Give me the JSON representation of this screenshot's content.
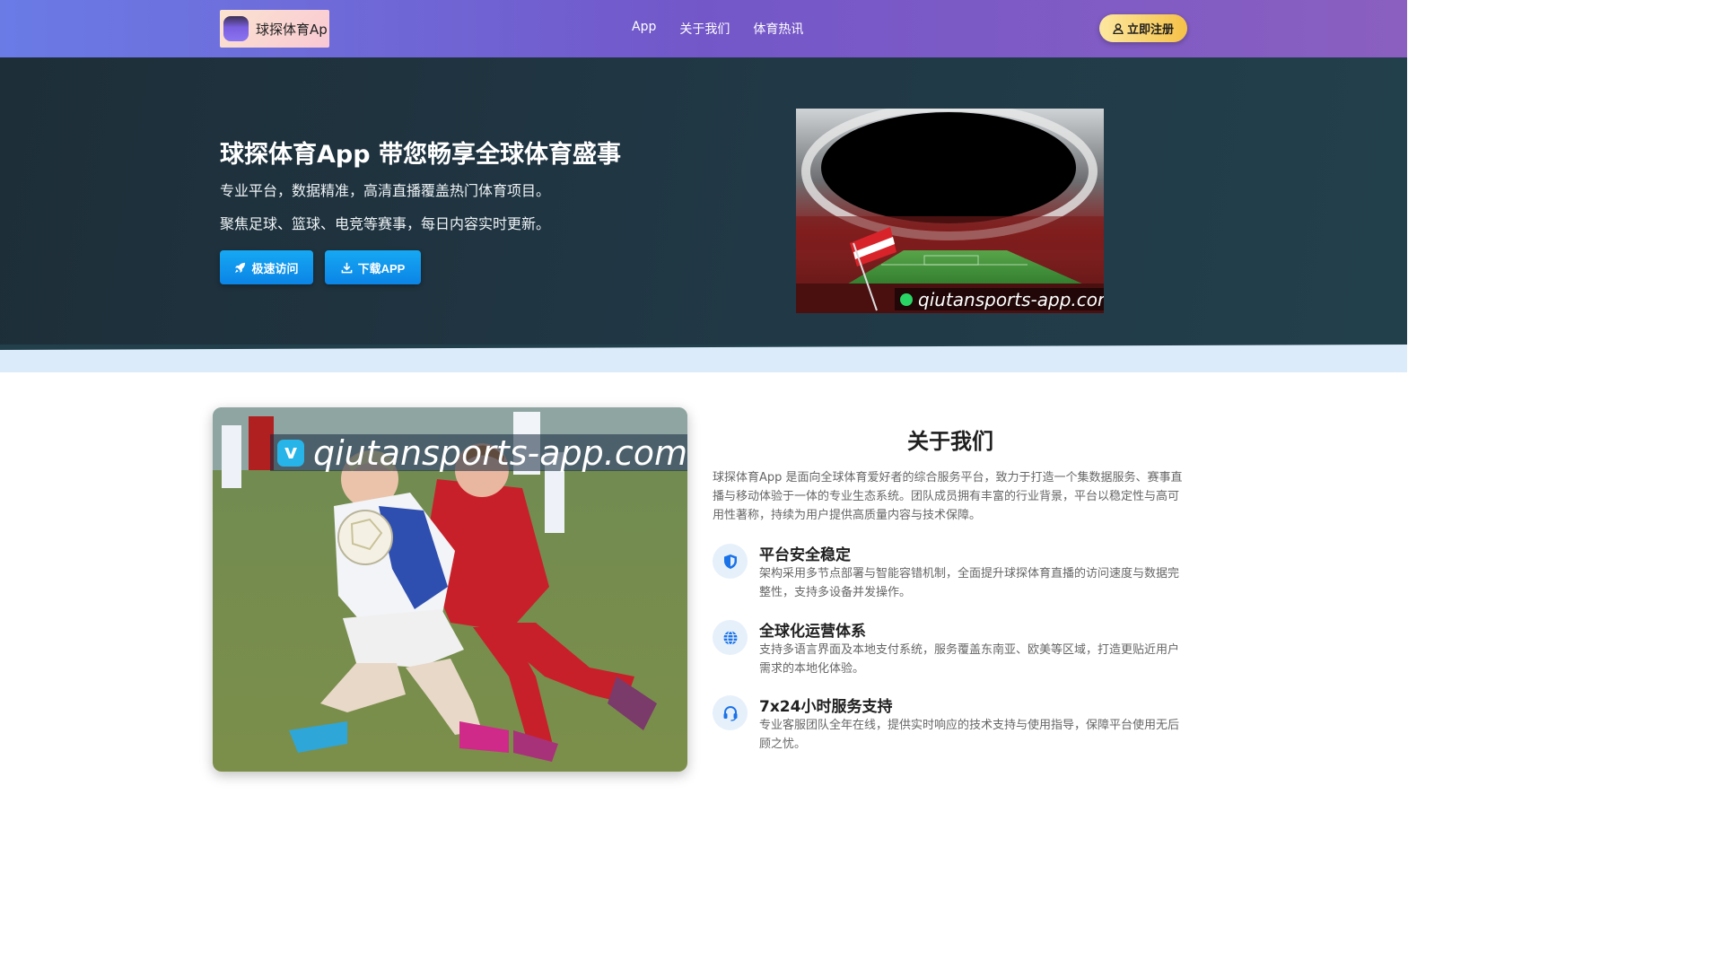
{
  "navbar": {
    "logo_text": "球探体育Ap",
    "links": [
      "App",
      "关于我们",
      "体育热讯"
    ],
    "register_label": "立即注册"
  },
  "hero": {
    "title": "球探体育App 带您畅享全球体育盛事",
    "subtitle_1": "专业平台，数据精准，高清直播覆盖热门体育项目。",
    "subtitle_2": "聚焦足球、篮球、电竞等赛事，每日内容实时更新。",
    "fast_access_label": "极速访问",
    "download_label": "下载APP",
    "image_watermark": "qiutansports-app.com"
  },
  "about": {
    "image_watermark": "qiutansports-app.com",
    "title": "关于我们",
    "description": "球探体育App 是面向全球体育爱好者的综合服务平台，致力于打造一个集数据服务、赛事直播与移动体验于一体的专业生态系统。团队成员拥有丰富的行业背景，平台以稳定性与高可用性著称，持续为用户提供高质量内容与技术保障。",
    "features": [
      {
        "title": "平台安全稳定",
        "desc": "架构采用多节点部署与智能容错机制，全面提升球探体育直播的访问速度与数据完整性，支持多设备并发操作。",
        "icon": "shield-icon"
      },
      {
        "title": "全球化运营体系",
        "desc": "支持多语言界面及本地支付系统，服务覆盖东南亚、欧美等区域，打造更贴近用户需求的本地化体验。",
        "icon": "globe-icon"
      },
      {
        "title": "7x24小时服务支持",
        "desc": "专业客服团队全年在线，提供实时响应的技术支持与使用指导，保障平台使用无后顾之忧。",
        "icon": "headset-icon"
      }
    ]
  },
  "colors": {
    "nav_gradient_start": "#6a7be6",
    "nav_gradient_end": "#8a5fc0",
    "hero_bg": "#1d2e38",
    "button_blue": "#0b84e6",
    "register_yellow": "#f6c147",
    "feature_icon_bg": "#e6f0fb",
    "feature_icon_fg": "#1a73e8"
  }
}
